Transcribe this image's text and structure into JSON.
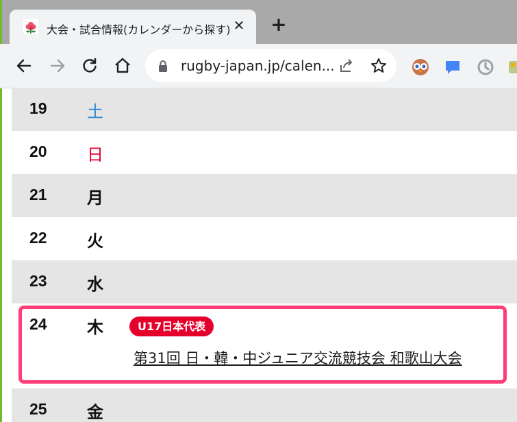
{
  "browser": {
    "tab_title": "大会・試合情報(カレンダーから探す)",
    "tab_close": "✕",
    "new_tab": "+",
    "url": "rugby-japan.jp/calen...",
    "icons": [
      "back-arrow-icon",
      "forward-arrow-icon",
      "reload-icon",
      "home-icon",
      "lock-icon",
      "share-icon",
      "bookmark-star-icon"
    ],
    "extensions": [
      "owl-extension-icon",
      "chat-extension-icon",
      "history-extension-icon",
      "puzzle-extension-icon"
    ]
  },
  "calendar": {
    "rows": [
      {
        "day": "19",
        "dow": "土",
        "type": "sat"
      },
      {
        "day": "20",
        "dow": "日",
        "type": "sun"
      },
      {
        "day": "21",
        "dow": "月",
        "type": "weekday"
      },
      {
        "day": "22",
        "dow": "火",
        "type": "weekday"
      },
      {
        "day": "23",
        "dow": "水",
        "type": "weekday"
      },
      {
        "day": "24",
        "dow": "木",
        "type": "weekday",
        "badge": "U17日本代表",
        "event": "第31回 日・韓・中ジュニア交流競技会 和歌山大会"
      },
      {
        "day": "25",
        "dow": "金",
        "type": "weekday"
      }
    ]
  },
  "colors": {
    "saturday": "#2f86d4",
    "sunday": "#e4002b",
    "badge_bg": "#e4002b",
    "highlight_frame": "#ff3d78",
    "row_shade": "#e5e5e5"
  }
}
